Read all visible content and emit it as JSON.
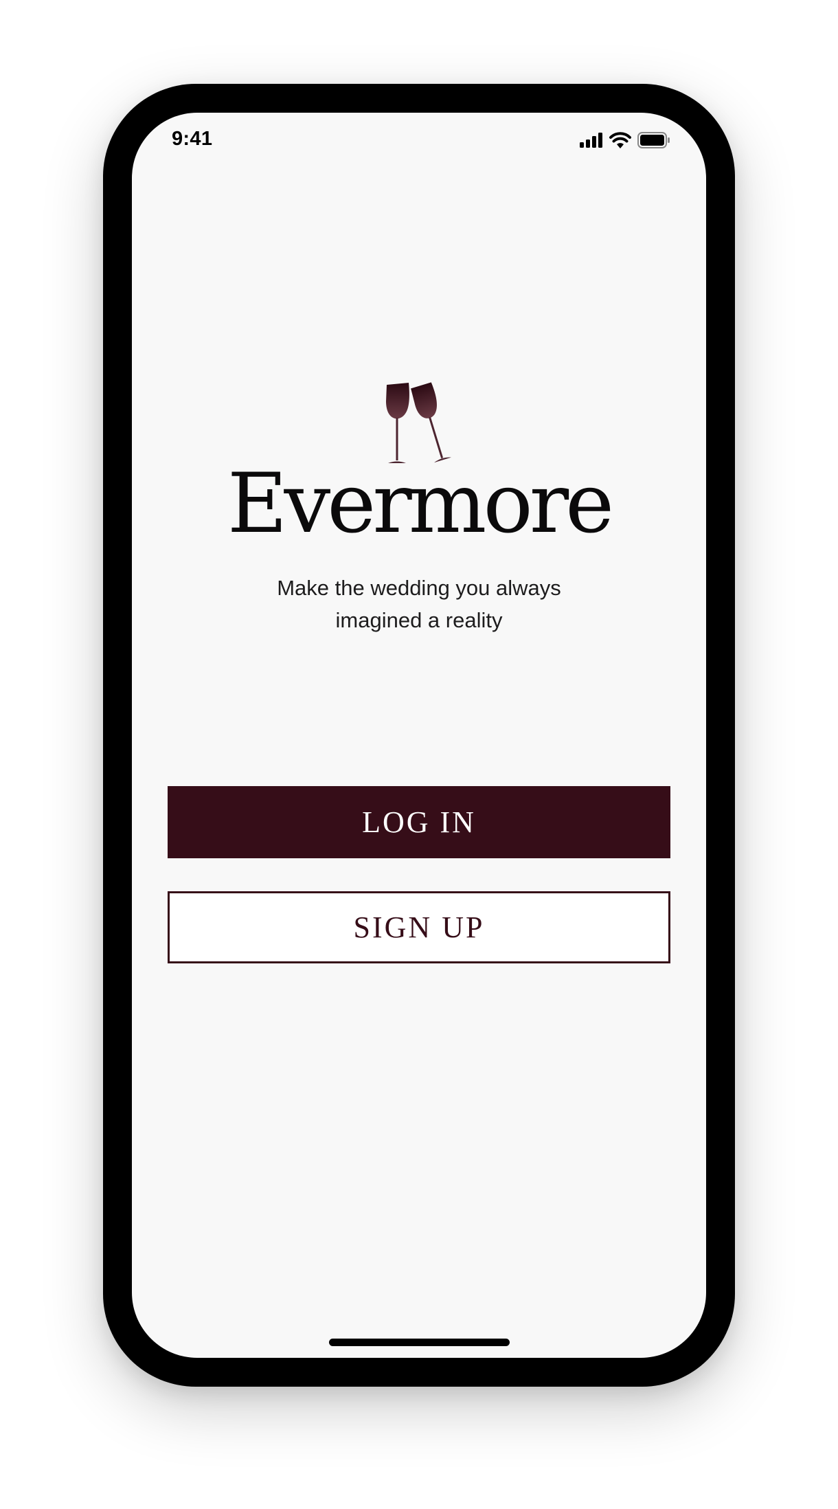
{
  "status_bar": {
    "time": "9:41",
    "icons": [
      "cellular-signal-icon",
      "wifi-icon",
      "battery-icon"
    ]
  },
  "logo": {
    "icon": "wine-glasses-toast-icon",
    "brand_name": "Evermore"
  },
  "tagline": "Make the wedding you always imagined a reality",
  "actions": {
    "login_label": "LOG IN",
    "signup_label": "SIGN UP"
  },
  "colors": {
    "primary": "#360d18",
    "background": "#f8f8f8",
    "text": "#0b0a0b"
  }
}
